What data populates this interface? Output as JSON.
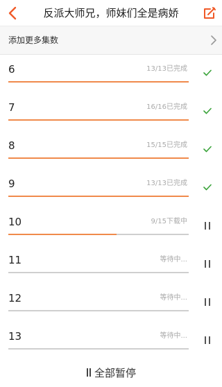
{
  "header": {
    "title": "反派大师兄，师妹们全是病娇",
    "accent_color": "#f05a28",
    "back_icon": "back-arrow-icon",
    "edit_icon": "edit-icon"
  },
  "add_more": {
    "label": "添加更多集数",
    "icon": "chevron-right-icon"
  },
  "episodes": [
    {
      "num": "6",
      "status": "13/13已完成",
      "progress": 1.0,
      "state": "done"
    },
    {
      "num": "7",
      "status": "16/16已完成",
      "progress": 1.0,
      "state": "done"
    },
    {
      "num": "8",
      "status": "15/15已完成",
      "progress": 1.0,
      "state": "done"
    },
    {
      "num": "9",
      "status": "13/13已完成",
      "progress": 1.0,
      "state": "done"
    },
    {
      "num": "10",
      "status": "9/15下载中",
      "progress": 0.6,
      "state": "downloading"
    },
    {
      "num": "11",
      "status": "等待中...",
      "progress": 0.0,
      "state": "waiting"
    },
    {
      "num": "12",
      "status": "等待中...",
      "progress": 0.0,
      "state": "waiting"
    },
    {
      "num": "13",
      "status": "等待中...",
      "progress": 0.0,
      "state": "waiting"
    }
  ],
  "colors": {
    "progress": "#f08a4b",
    "track": "#cfcfcf",
    "check": "#3aa33a"
  },
  "footer": {
    "pause_all_label": "全部暂停"
  }
}
